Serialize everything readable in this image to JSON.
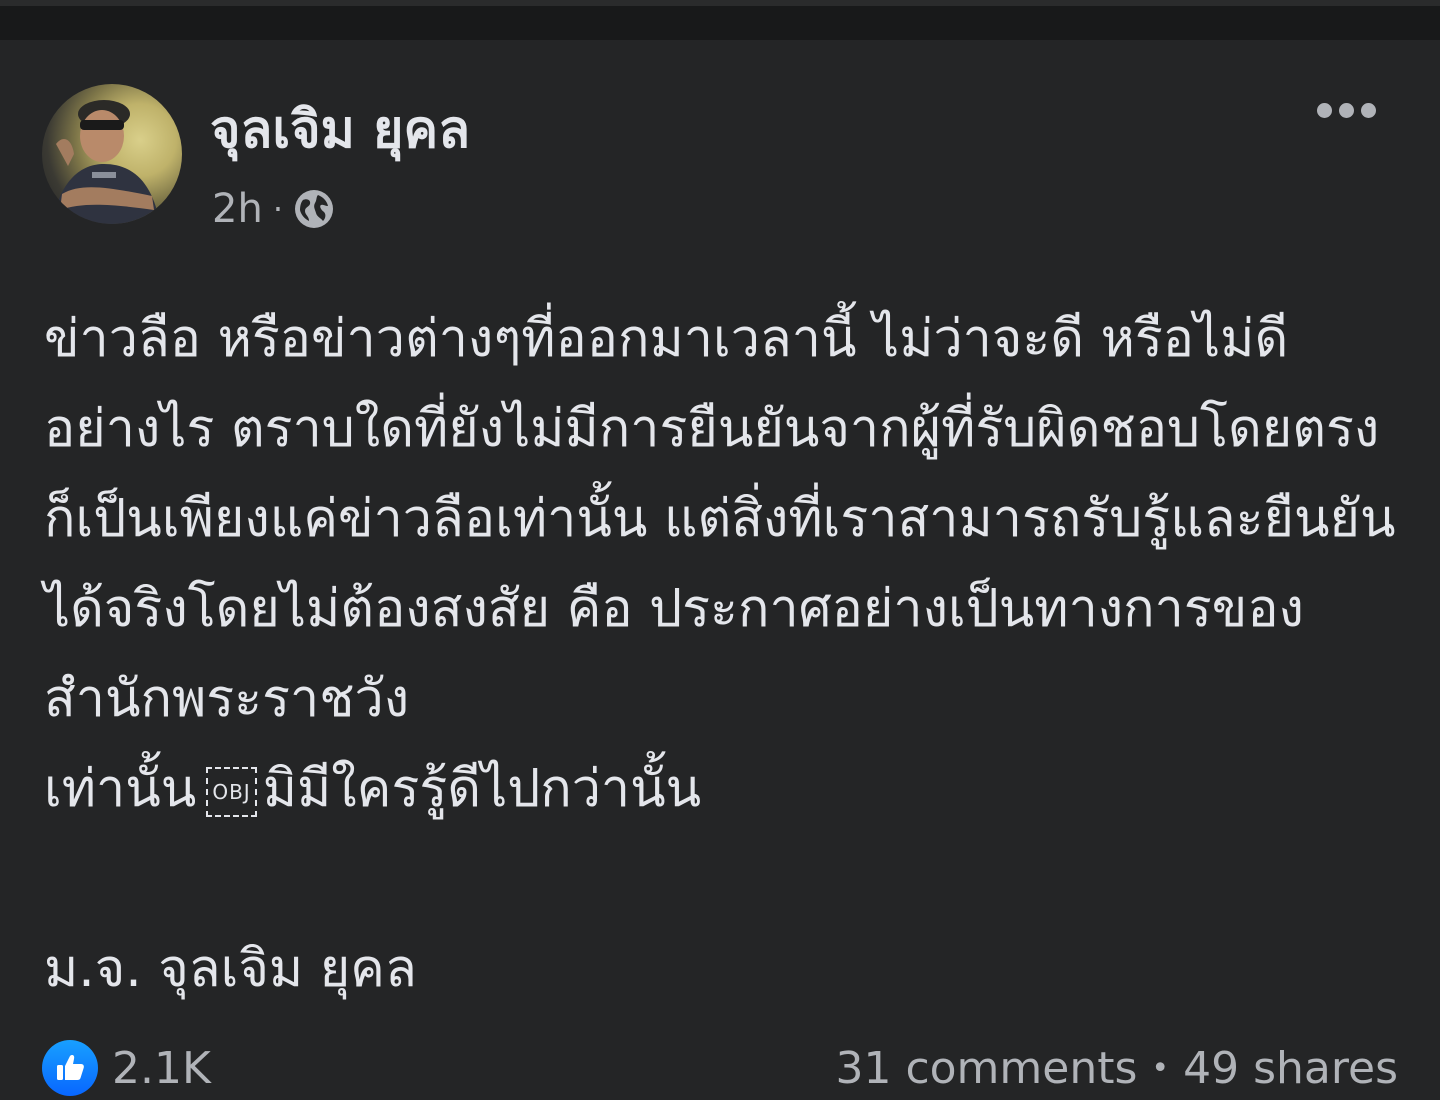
{
  "post": {
    "author": "จุลเจิม ยุคล",
    "time": "2h",
    "separator": "·",
    "privacy_icon": "globe-icon",
    "more_icon": "more-horizontal-icon",
    "body_paragraph": "ข่าวลือ หรือข่าวต่างๆที่ออกมาเวลานี้ ไม่ว่าจะดี หรือไม่ดีอย่างไร ตราบใดที่ยังไม่มีการยืนยันจากผู้ที่รับผิดชอบโดยตรง ก็เป็นเพียงแค่ข่าวลือเท่านั้น แต่สิ่งที่เราสามารถรับรู้และยืนยันได้จริงโดยไม่ต้องสงสัย คือ ประกาศอย่างเป็นทางการของ สำนักพระราชวัง",
    "body_last_line_before": "เท่านั้น",
    "obj_glyph": "OBJ",
    "body_last_line_after": "มิมีใครรู้ดีไปกว่านั้น",
    "signature": "ม.จ. จุลเจิม ยุคล"
  },
  "footer": {
    "like_icon": "thumbs-up-icon",
    "reaction_count": "2.1K",
    "comments": "31 comments",
    "dot": "•",
    "shares": "49 shares"
  },
  "colors": {
    "background": "#242526",
    "text_primary": "#e4e6eb",
    "text_secondary": "#b0b3b8",
    "like_blue": "#0866ff"
  }
}
